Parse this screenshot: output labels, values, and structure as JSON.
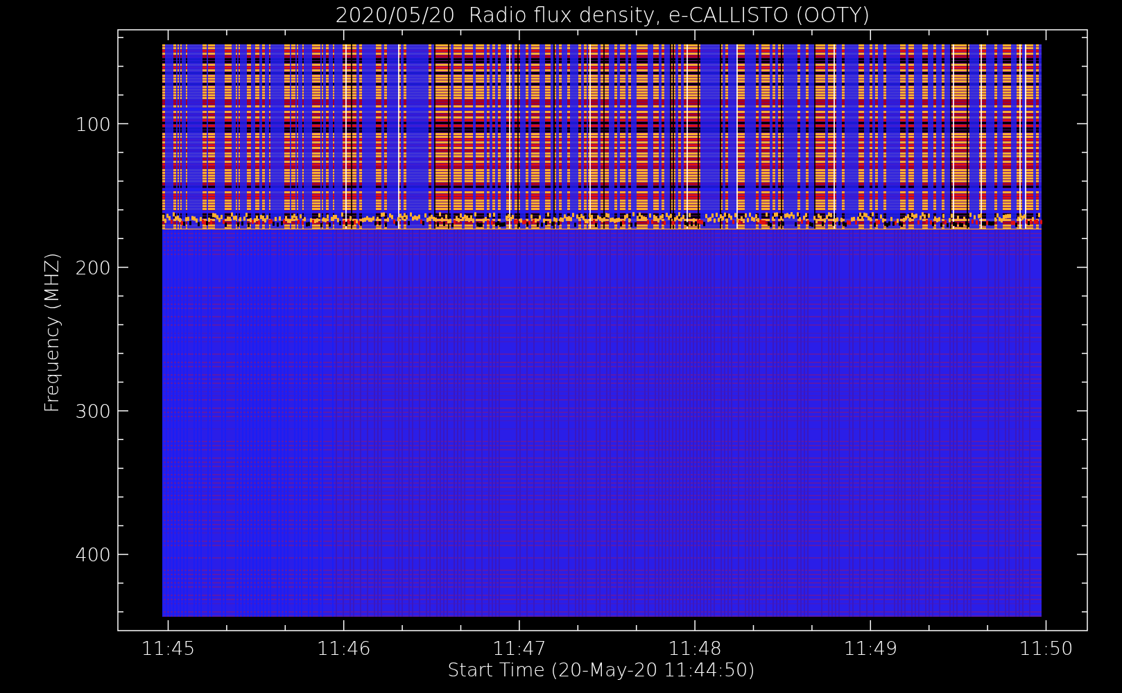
{
  "title": "2020/05/20  Radio flux density, e-CALLISTO (OOTY)",
  "plot": {
    "ylabel": "Frequency (MHZ)",
    "xlabel": "Start Time (20-May-20 11:44:50)",
    "yticks": [
      "100",
      "200",
      "300",
      "400"
    ],
    "xticks": [
      "11:45",
      "11:46",
      "11:47",
      "11:48",
      "11:49",
      "11:50"
    ]
  }
}
